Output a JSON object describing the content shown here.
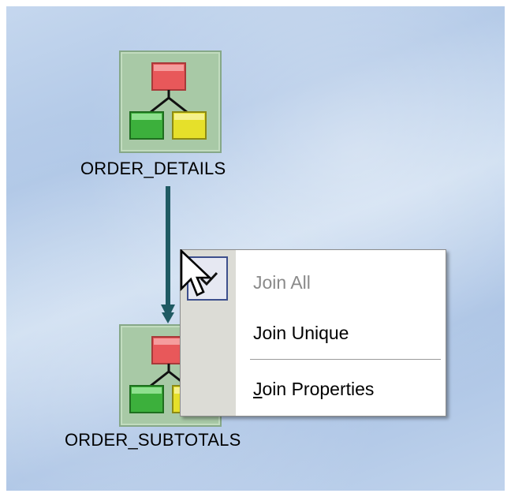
{
  "diagram": {
    "nodes": [
      {
        "name": "ORDER_DETAILS"
      },
      {
        "name": "ORDER_SUBTOTALS"
      }
    ]
  },
  "context_menu": {
    "items": [
      {
        "label": "Join All",
        "enabled": false,
        "checked": true
      },
      {
        "label": "Join Unique",
        "enabled": true,
        "checked": false
      },
      {
        "label_first": "J",
        "label_rest": "oin Properties",
        "enabled": true,
        "checked": false
      }
    ]
  },
  "colors": {
    "connector": "#1f5a63",
    "node_bg": "#a8c9a6",
    "red_table": "#e8585a",
    "green_table": "#3cb03c",
    "yellow_table": "#e6e02a"
  }
}
